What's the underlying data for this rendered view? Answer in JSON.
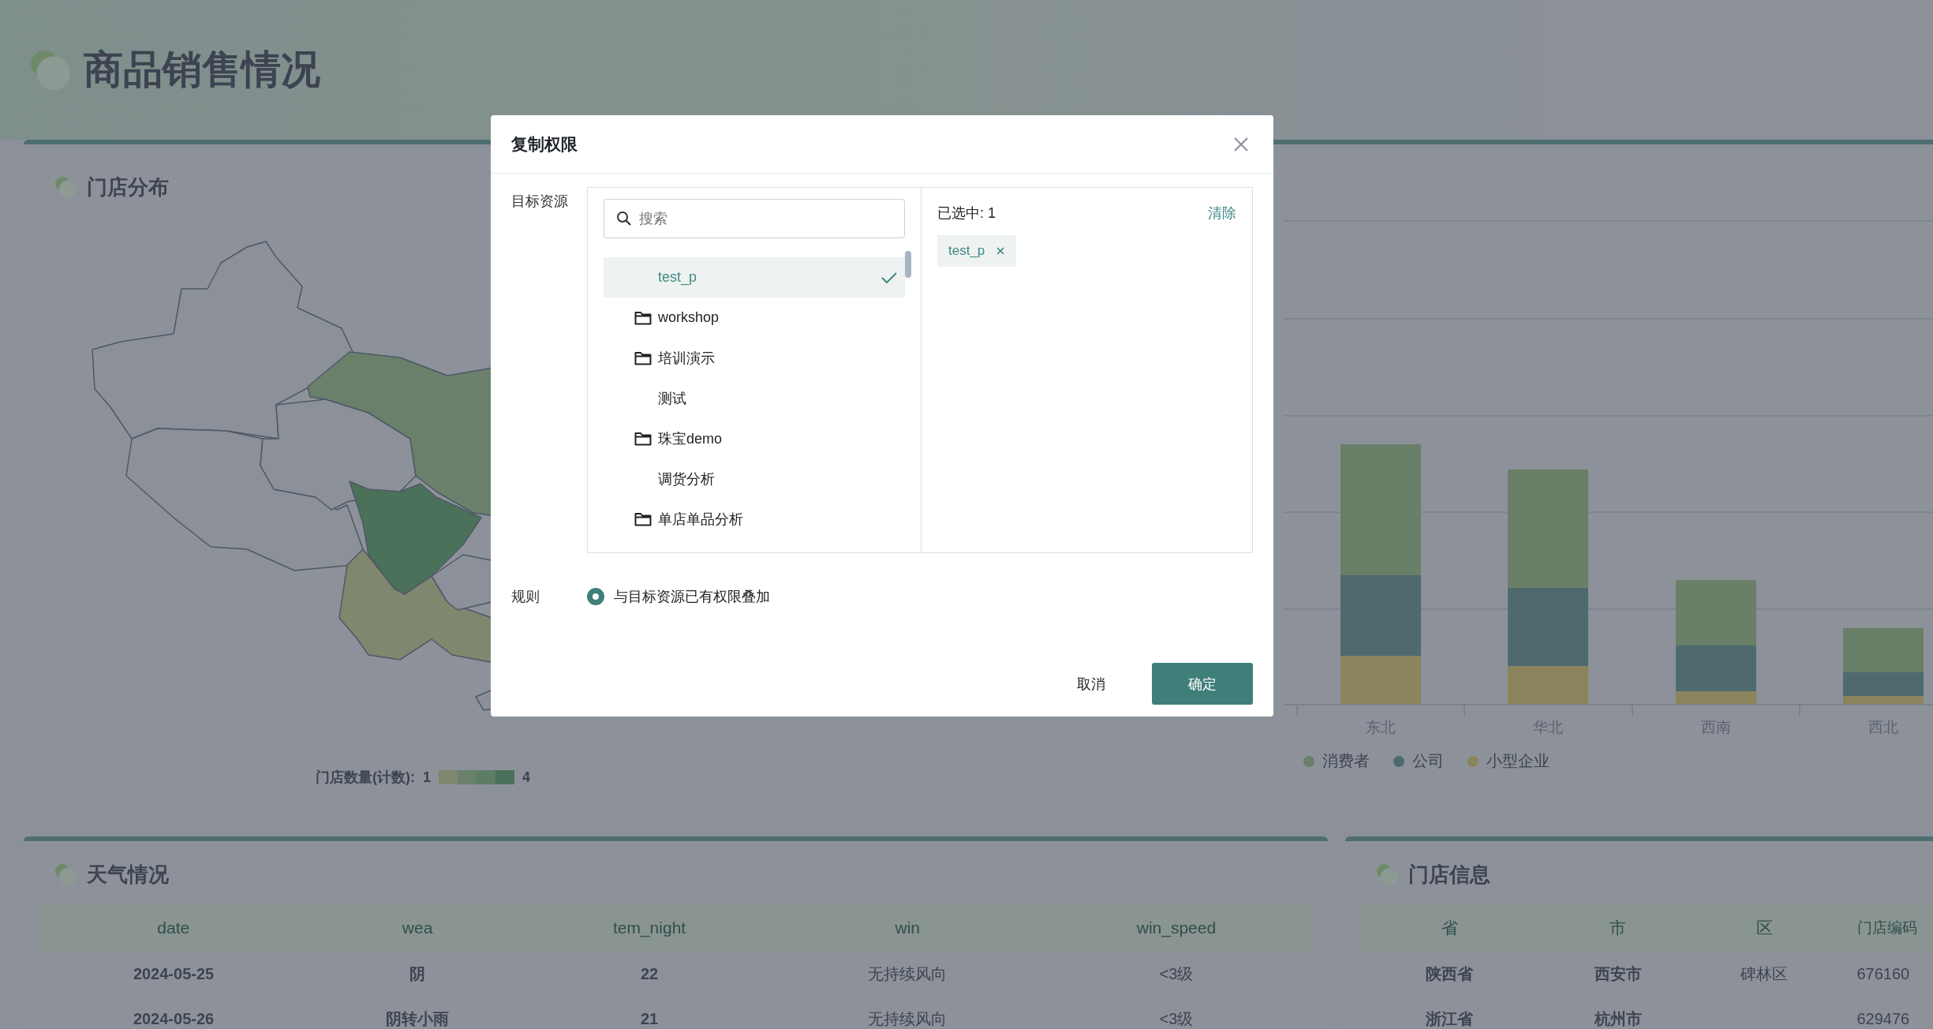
{
  "page": {
    "title": "商品销售情况"
  },
  "store_map": {
    "title": "门店分布",
    "legend": {
      "label": "门店数量(计数):",
      "min": "1",
      "max": "4"
    }
  },
  "sales_chart": {
    "categories": [
      "东北",
      "华北",
      "西南",
      "西北"
    ],
    "legend": [
      {
        "name": "消费者",
        "color": "#697f68"
      },
      {
        "name": "公司",
        "color": "#4e6a6f"
      },
      {
        "name": "小型企业",
        "color": "#8b845c"
      }
    ]
  },
  "weather": {
    "title": "天气情况",
    "columns": [
      "date",
      "wea",
      "tem_night",
      "win",
      "win_speed"
    ],
    "rows": [
      [
        "2024-05-25",
        "阴",
        "22",
        "无持续风向",
        "<3级"
      ],
      [
        "2024-05-26",
        "阴转小雨",
        "21",
        "无持续风向",
        "<3级"
      ]
    ]
  },
  "stores": {
    "title": "门店信息",
    "columns": [
      "省",
      "市",
      "区",
      "门店编码"
    ],
    "rows": [
      {
        "province": "陕西省",
        "city": "西安市",
        "district": "碑林区",
        "code": "676160"
      },
      {
        "province": "浙江省",
        "city": "杭州市",
        "code": "629476"
      }
    ]
  },
  "dialog": {
    "title": "复制权限",
    "target_label": "目标资源",
    "search": {
      "placeholder": "搜索"
    },
    "items": [
      {
        "kind": "file",
        "label": "test_p",
        "selected": true
      },
      {
        "kind": "folder",
        "label": "workshop",
        "selected": false
      },
      {
        "kind": "folder",
        "label": "培训演示",
        "selected": false
      },
      {
        "kind": "file",
        "label": "测试",
        "selected": false
      },
      {
        "kind": "folder",
        "label": "珠宝demo",
        "selected": false
      },
      {
        "kind": "file",
        "label": "调货分析",
        "selected": false
      },
      {
        "kind": "folder",
        "label": "单店单品分析",
        "selected": false
      }
    ],
    "selected_count": "已选中: 1",
    "clear": "清除",
    "tags": [
      "test_p"
    ],
    "rule_label": "规则",
    "rules": [
      {
        "label": "与目标资源已有权限叠加",
        "selected": true
      }
    ],
    "buttons": [
      {
        "kind": "secondary",
        "label": "取消"
      },
      {
        "kind": "primary",
        "label": "确定"
      }
    ]
  }
}
